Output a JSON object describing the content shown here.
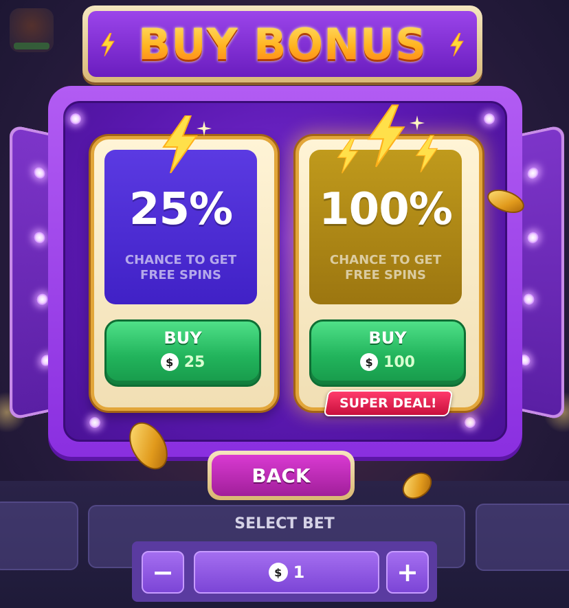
{
  "title": "BUY BONUS",
  "offers": [
    {
      "percent": "25%",
      "description": "CHANCE TO GET FREE SPINS",
      "buy_label": "BUY",
      "currency_symbol": "$",
      "price": "25"
    },
    {
      "percent": "100%",
      "description": "CHANCE TO GET FREE SPINS",
      "buy_label": "BUY",
      "currency_symbol": "$",
      "price": "100",
      "badge": "SUPER DEAL!"
    }
  ],
  "back_label": "BACK",
  "bet": {
    "label": "SELECT BET",
    "currency_symbol": "$",
    "value": "1",
    "minus_symbol": "−",
    "plus_symbol": "+"
  },
  "colors": {
    "title_gold": "#ffb21f",
    "card_purple": "#4021c6",
    "card_gold": "#9c7610",
    "buy_green": "#22b45c",
    "back_magenta": "#a11f9a",
    "badge_red": "#c8103c",
    "panel_purple": "#5a3ba0"
  },
  "icons": [
    "lightning-bolt-icon",
    "sparkle-icon",
    "coin-dollar-icon",
    "minus-icon",
    "plus-icon"
  ]
}
